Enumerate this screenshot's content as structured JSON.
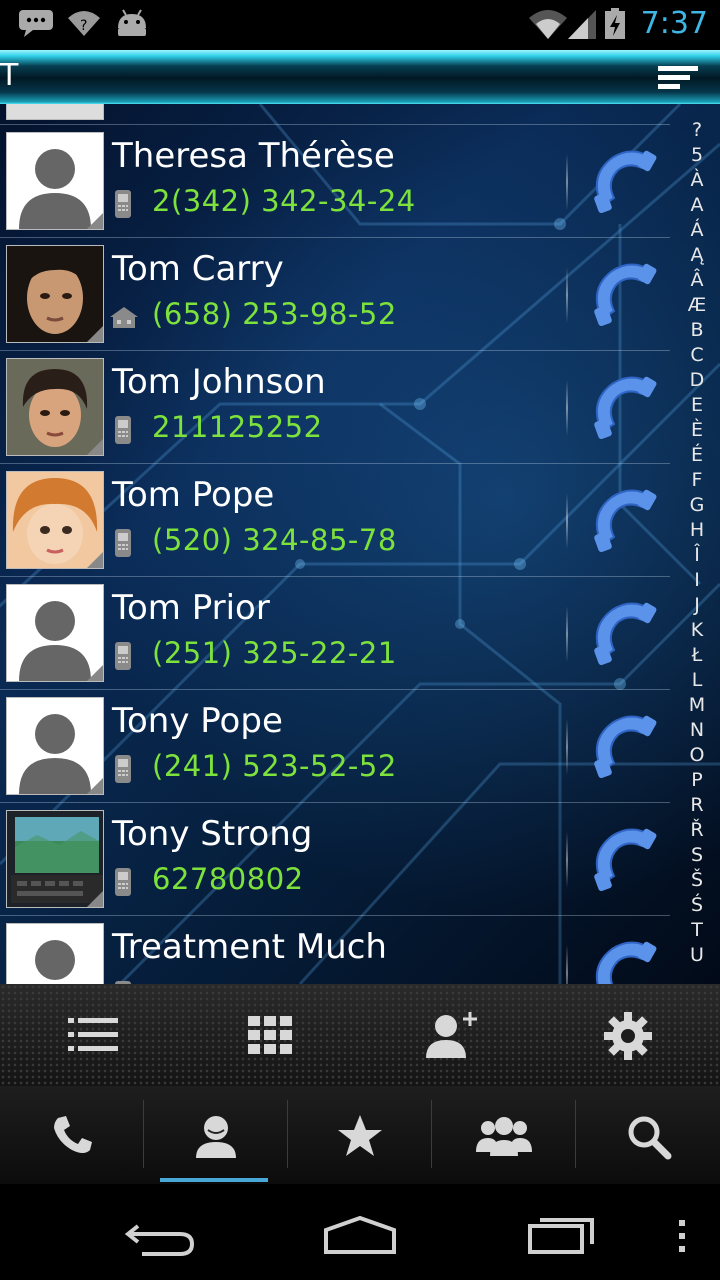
{
  "status_bar": {
    "time": "7:37",
    "left_icons": [
      "messages-icon",
      "wifi-unknown-icon",
      "android-icon"
    ],
    "right_icons": [
      "wifi-icon",
      "signal-icon",
      "battery-charging-icon"
    ]
  },
  "header": {
    "section_letter": "T",
    "menu_icon": "list-menu-icon"
  },
  "contacts": [
    {
      "name": "Theresa Thérèse",
      "phone": "2(342) 342-34-24",
      "phone_type": "mobile",
      "avatar": "placeholder"
    },
    {
      "name": "Tom Carry",
      "phone": "(658) 253-98-52",
      "phone_type": "home",
      "avatar": "photo"
    },
    {
      "name": "Tom Johnson",
      "phone": "211125252",
      "phone_type": "mobile",
      "avatar": "photo"
    },
    {
      "name": "Tom Pope",
      "phone": "(520) 324-85-78",
      "phone_type": "mobile",
      "avatar": "photo"
    },
    {
      "name": "Tom Prior",
      "phone": "(251) 325-22-21",
      "phone_type": "mobile",
      "avatar": "placeholder"
    },
    {
      "name": "Tony Pope",
      "phone": "(241) 523-52-52",
      "phone_type": "mobile",
      "avatar": "placeholder"
    },
    {
      "name": "Tony Strong",
      "phone": "62780802",
      "phone_type": "mobile",
      "avatar": "photo"
    },
    {
      "name": "Treatment Much",
      "phone": "",
      "phone_type": "mobile",
      "avatar": "placeholder"
    }
  ],
  "alphabet_index": [
    "?",
    "5",
    "À",
    "A",
    "Á",
    "Ą",
    "Â",
    "Æ",
    "B",
    "C",
    "D",
    "E",
    "È",
    "É",
    "F",
    "G",
    "H",
    "Î",
    "I",
    "J",
    "K",
    "Ł",
    "L",
    "M",
    "N",
    "O",
    "P",
    "R",
    "Ř",
    "S",
    "Š",
    "Ś",
    "T",
    "U"
  ],
  "toolbar": {
    "buttons": [
      "list-view-icon",
      "grid-view-icon",
      "add-contact-icon",
      "settings-icon"
    ]
  },
  "tabs": {
    "items": [
      "phone-tab-icon",
      "contacts-tab-icon",
      "favorites-tab-icon",
      "groups-tab-icon",
      "search-tab-icon"
    ],
    "active_index": 1
  },
  "nav_bar": {
    "buttons": [
      "back-icon",
      "home-icon",
      "recent-apps-icon",
      "overflow-menu-icon"
    ]
  },
  "colors": {
    "phone_text": "#7ee23c",
    "clock": "#3fb6e6",
    "call_icon": "#4f8ee8",
    "active_tab": "#4aa8d8"
  }
}
